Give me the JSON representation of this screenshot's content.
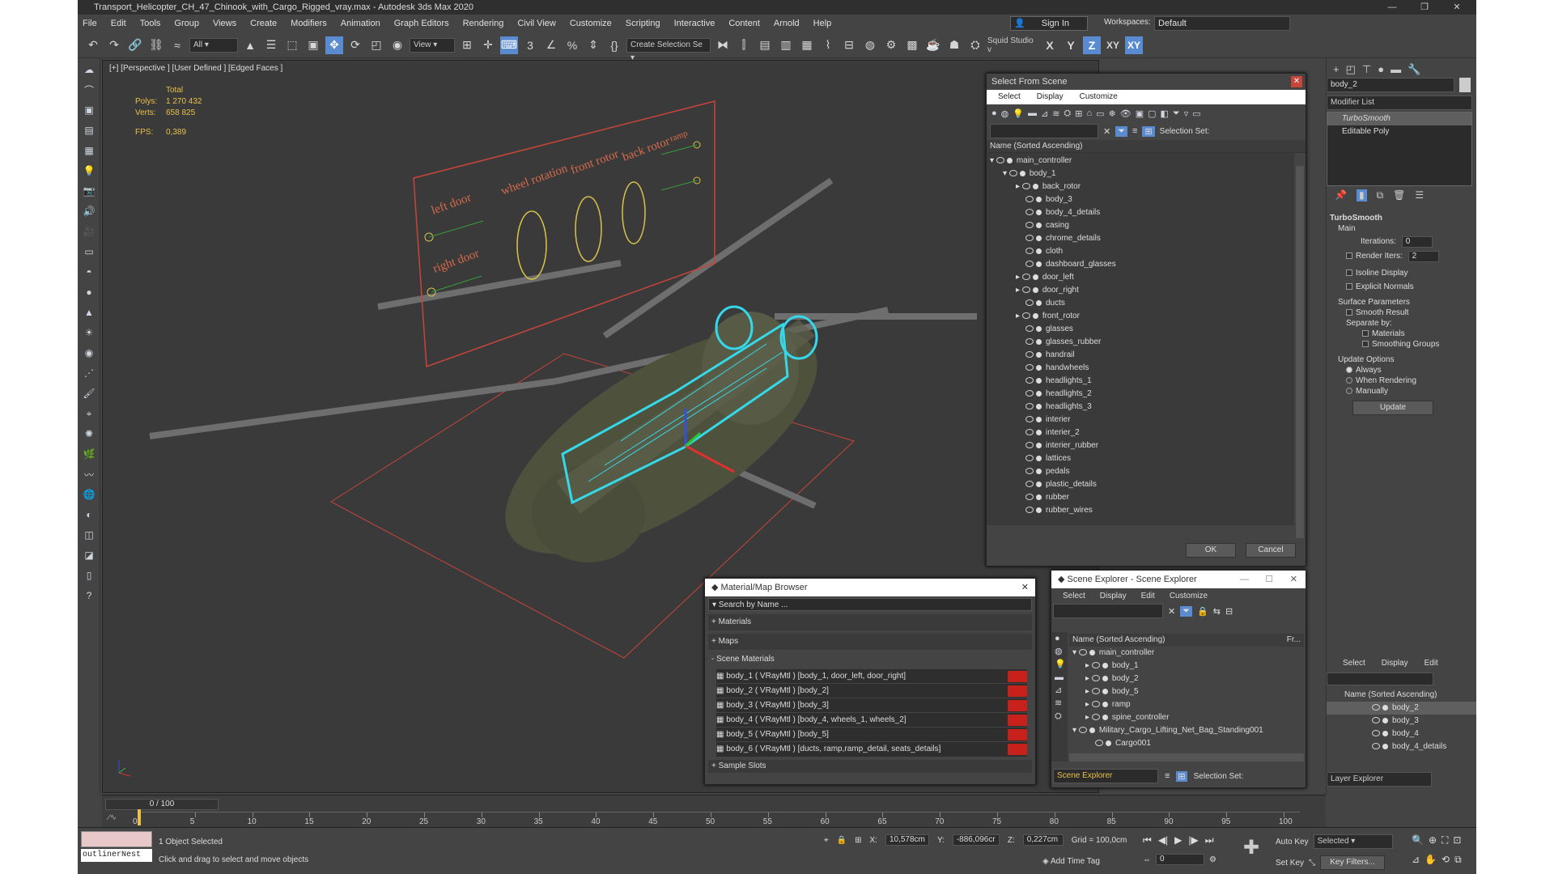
{
  "window": {
    "title": "Transport_Helicopter_CH_47_Chinook_with_Cargo_Rigged_vray.max - Autodesk 3ds Max 2020"
  },
  "menu": [
    "File",
    "Edit",
    "Tools",
    "Group",
    "Views",
    "Create",
    "Modifiers",
    "Animation",
    "Graph Editors",
    "Rendering",
    "Civil View",
    "Customize",
    "Scripting",
    "Interactive",
    "Content",
    "Arnold",
    "Help"
  ],
  "account": {
    "sign_in": "Sign In",
    "workspaces_label": "Workspaces:",
    "workspace": "Default"
  },
  "toolbar": {
    "filter": "All",
    "view": "View",
    "selection_set": "Create Selection Se",
    "squid": "Squid Studio v",
    "axes": [
      "X",
      "Y",
      "Z",
      "XY",
      "XY"
    ]
  },
  "viewport": {
    "label": "[+] [Perspective ] [User Defined ] [Edged Faces ]",
    "stats": {
      "total": "Total",
      "polys_label": "Polys:",
      "polys": "1 270 432",
      "verts_label": "Verts:",
      "verts": "658 825",
      "fps_label": "FPS:",
      "fps": "0,389"
    },
    "rig_labels": [
      "left door",
      "wheel rotation",
      "front rotor",
      "back rotor",
      "ramp",
      "right door"
    ]
  },
  "select_from_scene": {
    "title": "Select From Scene",
    "menu": [
      "Select",
      "Display",
      "Customize"
    ],
    "selection_set": "Selection Set:",
    "col": "Name (Sorted Ascending)",
    "items": [
      "main_controller",
      "body_1",
      "back_rotor",
      "body_3",
      "body_4_details",
      "casing",
      "chrome_details",
      "cloth",
      "dashboard_glasses",
      "door_left",
      "door_right",
      "ducts",
      "front_rotor",
      "glasses",
      "glasses_rubber",
      "handrail",
      "handwheels",
      "headlights_1",
      "headlights_2",
      "headlights_3",
      "interier",
      "interier_2",
      "interier_rubber",
      "lattices",
      "pedals",
      "plastic_details",
      "rubber",
      "rubber_wires"
    ],
    "ok": "OK",
    "cancel": "Cancel"
  },
  "material_browser": {
    "title": "Material/Map Browser",
    "search": "Search by Name ...",
    "sections": [
      "+ Materials",
      "+ Maps",
      "- Scene Materials"
    ],
    "materials": [
      "body_1 ( VRayMtl ) [body_1, door_left, door_right]",
      "body_2 ( VRayMtl ) [body_2]",
      "body_3 ( VRayMtl ) [body_3]",
      "body_4 ( VRayMtl ) [body_4, wheels_1, wheels_2]",
      "body_5 ( VRayMtl ) [body_5]",
      "body_6 ( VRayMtl ) [ducts, ramp,ramp_detail, seats_details]"
    ],
    "sample": "+ Sample Slots"
  },
  "scene_explorer": {
    "title": "Scene Explorer - Scene Explorer",
    "menu": [
      "Select",
      "Display",
      "Edit",
      "Customize"
    ],
    "col": "Name (Sorted Ascending)",
    "col2": "Fr...",
    "items": [
      "main_controller",
      "body_1",
      "body_2",
      "body_5",
      "ramp",
      "spine_controller",
      "Military_Cargo_Lifting_Net_Bag_Standing001",
      "Cargo001"
    ],
    "footer": "Scene Explorer",
    "selection_set": "Selection Set:"
  },
  "command_panel": {
    "object_name": "body_2",
    "modifier_list": "Modifier List",
    "stack": [
      "TurboSmooth",
      "Editable Poly"
    ],
    "rollout": "TurboSmooth",
    "main": "Main",
    "iterations_label": "Iterations:",
    "iterations": "0",
    "render_iters_label": "Render Iters:",
    "render_iters": "2",
    "isoline": "Isoline Display",
    "explicit": "Explicit Normals",
    "surface": "Surface Parameters",
    "smooth_result": "Smooth Result",
    "separate": "Separate by:",
    "materials": "Materials",
    "smoothing": "Smoothing Groups",
    "update_options": "Update Options",
    "always": "Always",
    "when_rendering": "When Rendering",
    "manually": "Manually",
    "update": "Update"
  },
  "layer_explorer": {
    "menu": [
      "Select",
      "Display",
      "Edit"
    ],
    "col": "Name (Sorted Ascending)",
    "items": [
      "body_2",
      "body_3",
      "body_4",
      "body_4_details"
    ],
    "footer": "Layer Explorer"
  },
  "timeline": {
    "frame": "0 / 100",
    "ticks": [
      "0",
      "5",
      "10",
      "15",
      "20",
      "25",
      "30",
      "35",
      "40",
      "45",
      "50",
      "55",
      "60",
      "65",
      "70",
      "75",
      "80",
      "85",
      "90",
      "95",
      "100"
    ]
  },
  "status": {
    "script": "outlinerNest",
    "selected": "1 Object Selected",
    "hint": "Click and drag to select and move objects",
    "x_label": "X:",
    "x": "10,578cm",
    "y_label": "Y:",
    "y": "-886,096cr",
    "z_label": "Z:",
    "z": "0,227cm",
    "grid": "Grid = 100,0cm",
    "add_time_tag": "Add Time Tag",
    "auto_key": "Auto Key",
    "set_key": "Set Key",
    "selected_dd": "Selected",
    "key_filters": "Key Filters...",
    "frame": "0"
  },
  "colors": {
    "accent": "#5a8bd0",
    "gizmo_cyan": "#35d8e8",
    "rig_orange": "#c8453a",
    "stats_yellow": "#e8c04a"
  }
}
